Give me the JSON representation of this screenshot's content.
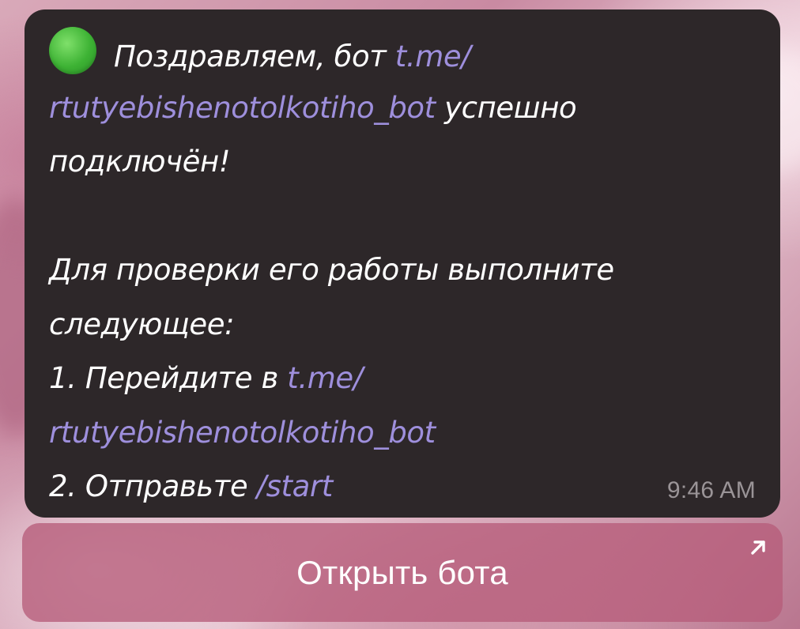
{
  "message": {
    "status_emoji": "green-circle",
    "intro_text": "Поздравляем, бот ",
    "bot_link_part1": "t.me/",
    "bot_link_part2": "rtutyebishenotolkotiho_bot",
    "connected_suffix": " успешно",
    "connected_text": "подключён!",
    "check_line1": "Для проверки его работы выполните",
    "check_line2": "следующее:",
    "step1_prefix": "1. Перейдите в ",
    "step1_link_part1": "t.me/",
    "step1_link_part2": "rtutyebishenotolkotiho_bot",
    "step2_prefix": "2. Отправьте ",
    "step2_command": "/start",
    "timestamp": "9:46 AM"
  },
  "inline_button": {
    "label": "Открыть бота",
    "icon": "arrow-up-right-icon"
  },
  "colors": {
    "bubble_bg": "#2d2729",
    "link": "#9e8fdc",
    "timestamp": "#9a9497",
    "button_bg": "#b65c7a"
  }
}
